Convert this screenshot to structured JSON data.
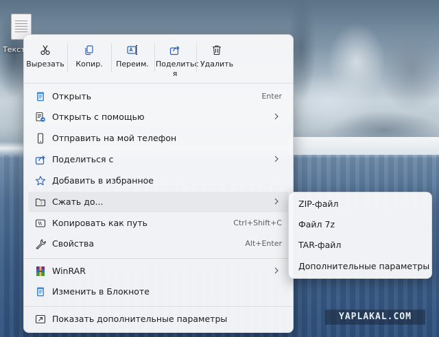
{
  "desktop": {
    "icon_label": "Текстовый документ"
  },
  "toolbar": {
    "buttons": [
      {
        "label": "Вырезать",
        "icon": "scissors-icon"
      },
      {
        "label": "Копир.",
        "icon": "copy-icon"
      },
      {
        "label": "Переим.",
        "icon": "rename-icon"
      },
      {
        "label": "Поделитьс я",
        "icon": "share-icon"
      },
      {
        "label": "Удалить",
        "icon": "trash-icon"
      }
    ]
  },
  "menu": {
    "open": {
      "label": "Открыть",
      "shortcut": "Enter",
      "icon": "notepad-icon"
    },
    "open_with": {
      "label": "Открыть с помощью",
      "icon": "open-with-icon"
    },
    "send_to_phone": {
      "label": "Отправить на мой телефон",
      "icon": "phone-icon"
    },
    "share_with": {
      "label": "Поделиться с",
      "icon": "share-icon"
    },
    "add_favorites": {
      "label": "Добавить в избранное",
      "icon": "star-icon"
    },
    "compress_to": {
      "label": "Сжать до...",
      "icon": "zip-folder-icon"
    },
    "copy_as_path": {
      "label": "Копировать как путь",
      "shortcut": "Ctrl+Shift+C",
      "icon": "path-icon"
    },
    "properties": {
      "label": "Свойства",
      "shortcut": "Alt+Enter",
      "icon": "wrench-icon"
    },
    "winrar": {
      "label": "WinRAR",
      "icon": "winrar-icon"
    },
    "edit_notepad": {
      "label": "Изменить в Блокноте",
      "icon": "notepad-icon"
    },
    "more_options": {
      "label": "Показать дополнительные параметры",
      "icon": "more-options-icon"
    }
  },
  "submenu": {
    "items": [
      {
        "label": "ZIP-файл"
      },
      {
        "label": "Файл 7z"
      },
      {
        "label": "TAR-файл"
      },
      {
        "label": "Дополнительные параметры"
      }
    ]
  },
  "watermark": {
    "text": "YAPLAKAL.COM"
  }
}
